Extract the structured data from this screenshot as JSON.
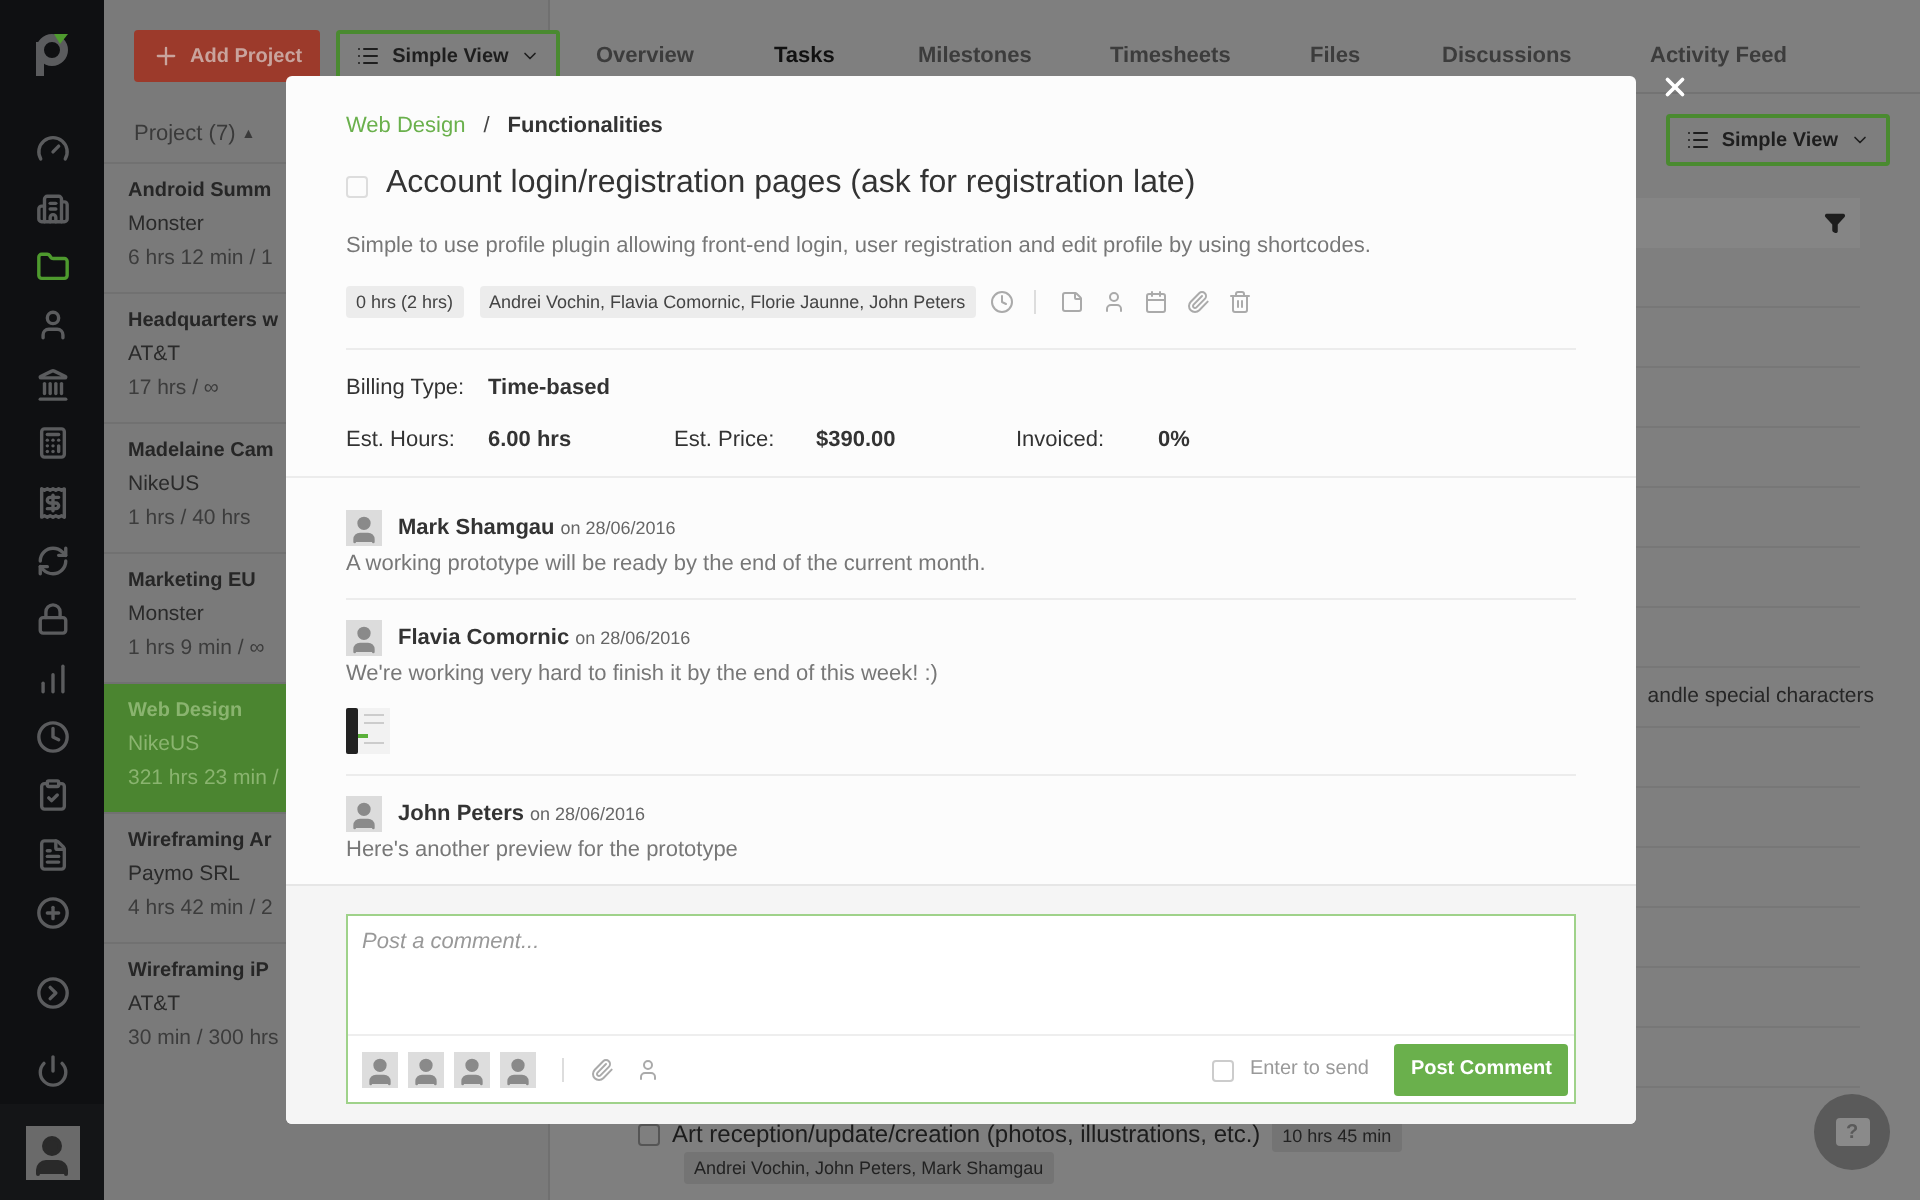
{
  "sidebar": {
    "items": [
      {
        "selected": false
      },
      {
        "selected": false
      },
      {
        "selected": true
      },
      {
        "selected": false
      },
      {
        "selected": false
      },
      {
        "selected": false
      },
      {
        "selected": false
      },
      {
        "selected": false
      },
      {
        "selected": false
      },
      {
        "selected": false
      },
      {
        "selected": false
      },
      {
        "selected": false
      },
      {
        "selected": false
      },
      {
        "selected": false
      },
      {
        "selected": false
      },
      {
        "selected": false
      }
    ]
  },
  "toolbar": {
    "add_button": "Add Project",
    "view_button": "Simple View"
  },
  "project_list": {
    "header": "Project (7)",
    "sort_marker": "▲",
    "projects": [
      {
        "name": "Android Summ",
        "client": "Monster",
        "time": "6 hrs 12 min / 1",
        "selected": false
      },
      {
        "name": "Headquarters w",
        "client": "AT&T",
        "time": "17 hrs / ∞",
        "selected": false
      },
      {
        "name": "Madelaine Cam",
        "client": "NikeUS",
        "time": "1 hrs / 40 hrs",
        "selected": false
      },
      {
        "name": "Marketing EU",
        "client": "Monster",
        "time": "1 hrs 9 min / ∞",
        "selected": false
      },
      {
        "name": "Web Design",
        "client": "NikeUS",
        "time": "321 hrs 23 min /",
        "selected": true
      },
      {
        "name": "Wireframing Ar",
        "client": "Paymo SRL",
        "time": "4 hrs 42 min / 2",
        "selected": false
      },
      {
        "name": "Wireframing iP",
        "client": "AT&T",
        "time": "30 min / 300 hrs",
        "selected": false
      }
    ]
  },
  "tabs": [
    {
      "label": "Overview",
      "selected": false
    },
    {
      "label": "Tasks",
      "selected": true
    },
    {
      "label": "Milestones",
      "selected": false
    },
    {
      "label": "Timesheets",
      "selected": false
    },
    {
      "label": "Files",
      "selected": false
    },
    {
      "label": "Discussions",
      "selected": false
    },
    {
      "label": "Activity Feed",
      "selected": false
    }
  ],
  "main_toolbar": {
    "view_button": "Simple View"
  },
  "tasks": [
    {
      "kind": "partial",
      "text": "andle special characters"
    },
    {
      "kind": "task",
      "text": "Art reception/update/creation (photos, illustrations, etc.)",
      "checked": false,
      "time": "10 hrs 45 min",
      "users": "Andrei Vochin, John Peters, Mark Shamgau"
    }
  ],
  "modal": {
    "breadcrumb": {
      "parent": "Web Design",
      "separator": "/",
      "current": "Functionalities"
    },
    "task": {
      "title": "Account login/registration pages (ask for registration late)",
      "checked": false,
      "description": "Simple to use profile plugin allowing front-end login, user registration and edit profile by using shortcodes.",
      "tags": [
        "0 hrs (2 hrs)",
        "Andrei Vochin, Flavia Comornic, Florie Jaunne, John Peters"
      ]
    },
    "billing": {
      "label": "Billing Type:",
      "value": "Time-based"
    },
    "estimates": [
      {
        "label": "Est. Hours:",
        "value": "6.00 hrs"
      },
      {
        "label": "Est. Price:",
        "value": "$390.00"
      },
      {
        "label": "Invoiced:",
        "value": "0%"
      }
    ],
    "comments": [
      {
        "author": "Mark Shamgau",
        "date": "on 28/06/2016",
        "text": "A working prototype will be ready by the end of the current month.",
        "attachment": false
      },
      {
        "author": "Flavia Comornic",
        "date": "on 28/06/2016",
        "text": "We're working very hard to finish it by the end of this week! :)",
        "attachment": true
      },
      {
        "author": "John Peters",
        "date": "on 28/06/2016",
        "text": "Here's another preview for the prototype",
        "attachment": false
      }
    ],
    "composer": {
      "placeholder": "Post a comment...",
      "enter_to_send": {
        "label": "Enter to send",
        "checked": false
      },
      "button": "Post Comment"
    }
  },
  "help_button": {
    "label": "?"
  }
}
